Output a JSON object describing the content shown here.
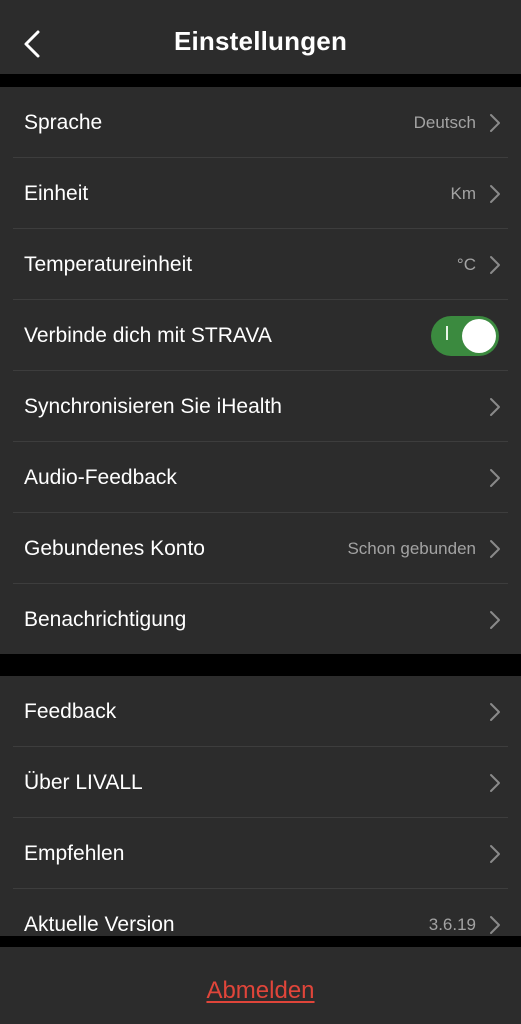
{
  "header": {
    "title": "Einstellungen",
    "back_icon": "chevron-left-icon"
  },
  "settings_group_1": {
    "items": [
      {
        "label": "Sprache",
        "value": "Deutsch"
      },
      {
        "label": "Einheit",
        "value": "Km"
      },
      {
        "label": "Temperatureinheit",
        "value": "°C"
      },
      {
        "label": "Verbinde dich mit STRAVA",
        "toggle_on": true
      },
      {
        "label": "Synchronisieren Sie iHealth"
      },
      {
        "label": "Audio-Feedback"
      },
      {
        "label": "Gebundenes Konto",
        "value": "Schon gebunden"
      },
      {
        "label": "Benachrichtigung"
      }
    ]
  },
  "settings_group_2": {
    "items": [
      {
        "label": "Feedback"
      },
      {
        "label": "Über LIVALL"
      },
      {
        "label": "Empfehlen"
      },
      {
        "label": "Aktuelle Version",
        "value": "3.6.19"
      }
    ]
  },
  "footer": {
    "logout_label": "Abmelden"
  },
  "colors": {
    "background": "#000000",
    "surface": "#2c2c2c",
    "toggle_on": "#3b8a3f",
    "logout": "#e0453a",
    "secondary_text": "#a3a3a3"
  }
}
